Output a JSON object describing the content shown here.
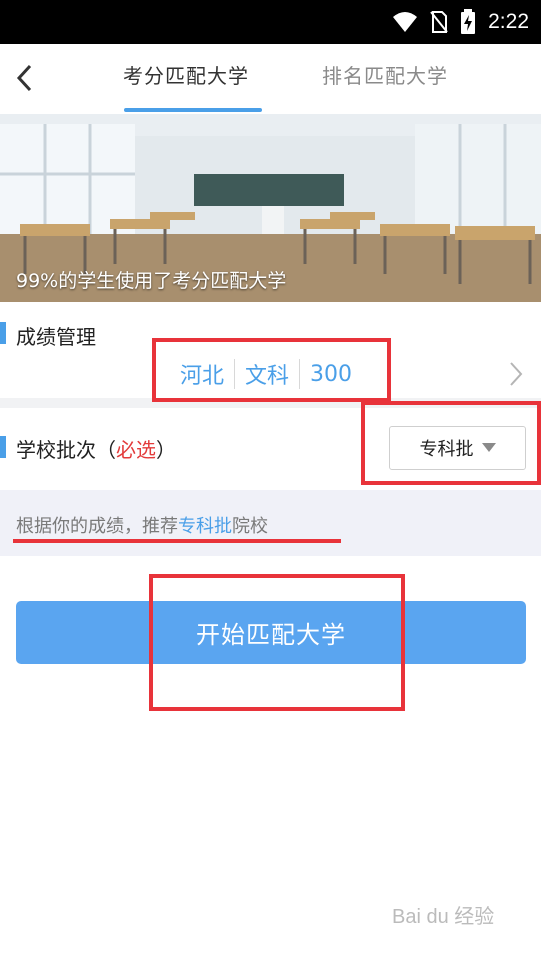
{
  "status_bar": {
    "time": "2:22",
    "icons": [
      "wifi-icon",
      "no-sim-icon",
      "battery-charging-icon"
    ]
  },
  "header": {
    "tabs": [
      {
        "label": "考分匹配大学",
        "active": true
      },
      {
        "label": "排名匹配大学",
        "active": false
      }
    ]
  },
  "banner": {
    "caption": "99%的学生使用了考分匹配大学"
  },
  "score_section": {
    "title": "成绩管理",
    "province": "河北",
    "subject": "文科",
    "score": "300"
  },
  "batch_section": {
    "title_prefix": "学校批次（",
    "required_label": "必选",
    "title_suffix": "）",
    "selected": "专科批"
  },
  "recommendation": {
    "prefix": "根据你的成绩，推荐",
    "highlight": "专科批",
    "suffix": "院校"
  },
  "start_button": {
    "label": "开始匹配大学"
  },
  "watermark": {
    "text": "Bai du 经验"
  },
  "colors": {
    "accent": "#4a9fe8",
    "required": "#e33b3b",
    "annotation": "#e8333a",
    "button": "#5aa5f0"
  }
}
